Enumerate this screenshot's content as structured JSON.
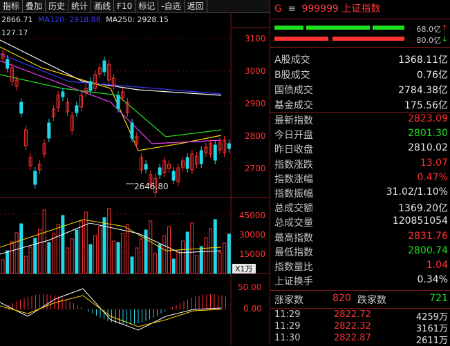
{
  "toolbar": [
    "指标",
    "叠加",
    "历史",
    "统计",
    "画线",
    "F10",
    "标记",
    "-自选",
    "返回"
  ],
  "ma_text": {
    "prev": "2866.71",
    "ma120": "MA120: 2918.88",
    "ma250": "MA250: 2928.15"
  },
  "top_left_value": "127.17",
  "y_axis_price": [
    "3100",
    "3000",
    "2900",
    "2800",
    "2700"
  ],
  "low_label": "2646.80",
  "y_axis_volume": [
    "45000",
    "30000",
    "15000",
    "X1万"
  ],
  "y_axis_macd": [
    "50.00",
    "0.00"
  ],
  "header": {
    "letter": "G",
    "icon": "≡",
    "code": "999999",
    "name": "上证指数"
  },
  "flow_bars": [
    {
      "value": "68.0亿",
      "arrow": "↑",
      "color": "#1ee01e"
    },
    {
      "value": "80.0亿",
      "arrow": "↓",
      "color": "#ff3232"
    }
  ],
  "turnover": [
    {
      "label": "A股成交",
      "value": "1368.11亿"
    },
    {
      "label": "B股成交",
      "value": "0.76亿"
    },
    {
      "label": "国债成交",
      "value": "2784.38亿"
    },
    {
      "label": "基金成交",
      "value": "175.56亿"
    }
  ],
  "quote": [
    {
      "label": "最新指数",
      "value": "2823.09",
      "color": "red"
    },
    {
      "label": "今日开盘",
      "value": "2801.30",
      "color": "green"
    },
    {
      "label": "昨日收盘",
      "value": "2810.02",
      "color": "white"
    },
    {
      "label": "指数涨跌",
      "value": "13.07",
      "color": "red"
    },
    {
      "label": "指数涨幅",
      "value": "0.47%",
      "color": "red"
    },
    {
      "label": "指数振幅",
      "value": "31.02/1.10%",
      "color": "white"
    },
    {
      "label": "总成交额",
      "value": "1369.20亿",
      "color": "white"
    },
    {
      "label": "总成交量",
      "value": "120851054",
      "color": "white"
    },
    {
      "label": "最高指数",
      "value": "2831.76",
      "color": "red"
    },
    {
      "label": "最低指数",
      "value": "2800.74",
      "color": "green"
    },
    {
      "label": "指数量比",
      "value": "1.04",
      "color": "red"
    },
    {
      "label": "上证换手",
      "value": "0.34%",
      "color": "white"
    }
  ],
  "breadth": {
    "up_label": "涨家数",
    "up_value": "820",
    "down_label": "跌家数",
    "down_value": "721"
  },
  "ticks": [
    {
      "time": "11:29",
      "price": "2822.72",
      "vol": "4259万"
    },
    {
      "time": "11:29",
      "price": "2822.32",
      "vol": "3161万"
    },
    {
      "time": "11:30",
      "price": "2822.87",
      "vol": "2611万"
    }
  ],
  "colors": {
    "up": "#ff3232",
    "down": "#1ee01e",
    "border": "#7a1a1a"
  }
}
